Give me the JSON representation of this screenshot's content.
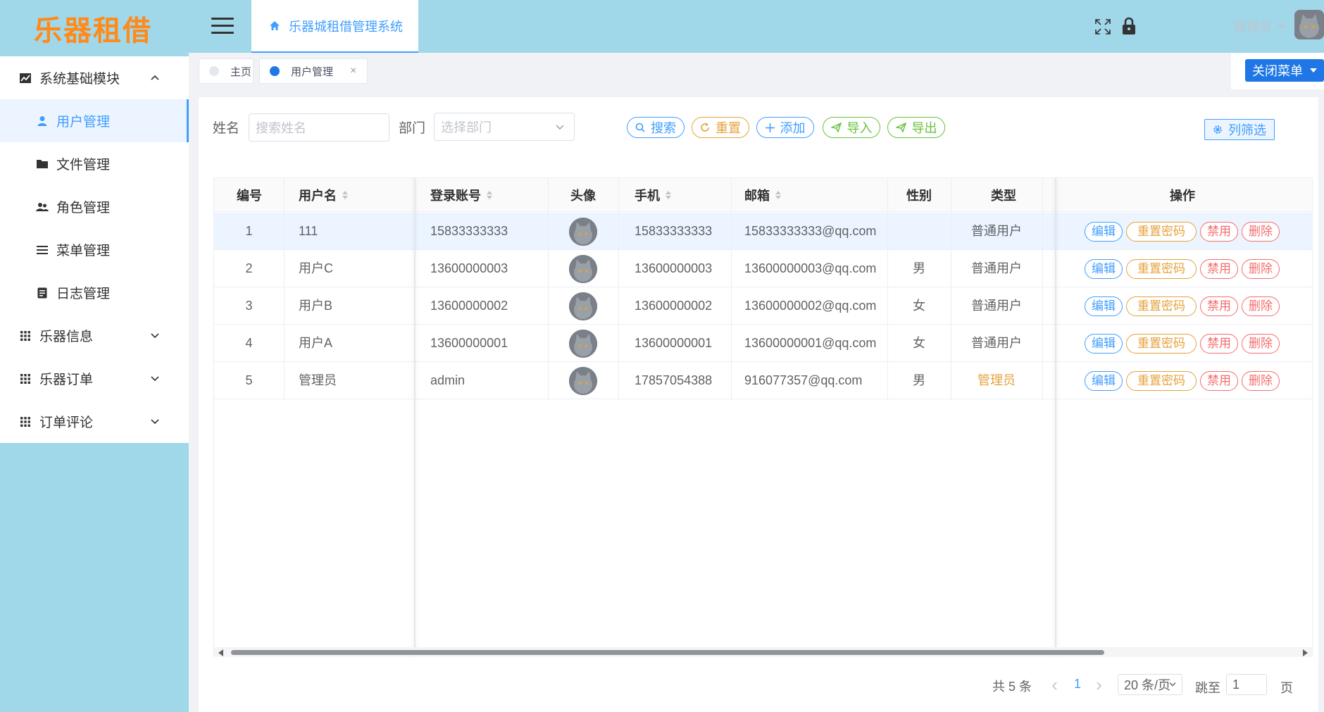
{
  "app": {
    "logo": "乐器租借"
  },
  "header": {
    "system_tab": "乐器城租借管理系统",
    "user_name": "管理员"
  },
  "sidebar": {
    "items": [
      {
        "label": "系统基础模块",
        "icon": "chart-icon",
        "level": "top",
        "expanded": true
      },
      {
        "label": "用户管理",
        "icon": "user-icon",
        "level": "sub",
        "active": true
      },
      {
        "label": "文件管理",
        "icon": "folder-icon",
        "level": "sub"
      },
      {
        "label": "角色管理",
        "icon": "group-icon",
        "level": "sub"
      },
      {
        "label": "菜单管理",
        "icon": "menu-lines-icon",
        "level": "sub"
      },
      {
        "label": "日志管理",
        "icon": "log-icon",
        "level": "sub"
      },
      {
        "label": "乐器信息",
        "icon": "grid-icon",
        "level": "top",
        "expanded": false
      },
      {
        "label": "乐器订单",
        "icon": "grid-icon",
        "level": "top",
        "expanded": false
      },
      {
        "label": "订单评论",
        "icon": "grid-icon",
        "level": "top",
        "expanded": false
      }
    ]
  },
  "tags": {
    "home": "主页",
    "current": "用户管理",
    "close_menu": "关闭菜单"
  },
  "filters": {
    "name_label": "姓名",
    "name_placeholder": "搜索姓名",
    "dept_label": "部门",
    "dept_placeholder": "选择部门"
  },
  "toolbar": {
    "search": "搜索",
    "reset": "重置",
    "add": "添加",
    "import": "导入",
    "export": "导出",
    "column_filter": "列筛选"
  },
  "table": {
    "columns": [
      "编号",
      "用户名",
      "登录账号",
      "头像",
      "手机",
      "邮箱",
      "性别",
      "类型",
      "操作"
    ],
    "rows": [
      {
        "id": "1",
        "username": "111",
        "account": "15833333333",
        "phone": "15833333333",
        "email": "15833333333@qq.com",
        "gender": "",
        "type": "普通用户"
      },
      {
        "id": "2",
        "username": "用户C",
        "account": "13600000003",
        "phone": "13600000003",
        "email": "13600000003@qq.com",
        "gender": "男",
        "type": "普通用户"
      },
      {
        "id": "3",
        "username": "用户B",
        "account": "13600000002",
        "phone": "13600000002",
        "email": "13600000002@qq.com",
        "gender": "女",
        "type": "普通用户"
      },
      {
        "id": "4",
        "username": "用户A",
        "account": "13600000001",
        "phone": "13600000001",
        "email": "13600000001@qq.com",
        "gender": "女",
        "type": "普通用户"
      },
      {
        "id": "5",
        "username": "管理员",
        "account": "admin",
        "phone": "17857054388",
        "email": "916077357@qq.com",
        "gender": "男",
        "type": "管理员"
      }
    ],
    "actions": {
      "edit": "编辑",
      "reset_password": "重置密码",
      "disable": "禁用",
      "delete": "删除"
    }
  },
  "pagination": {
    "total": "共 5 条",
    "current_page": "1",
    "page_size": "20 条/页",
    "goto_label": "跳至",
    "goto_value": "1",
    "page_suffix": "页"
  },
  "colors": {
    "accent": "#409eff",
    "header_bg": "#a0d8e9",
    "logo": "#ff8a1a",
    "warning": "#e6a23c",
    "success": "#67c23a",
    "danger": "#f56c6c"
  }
}
